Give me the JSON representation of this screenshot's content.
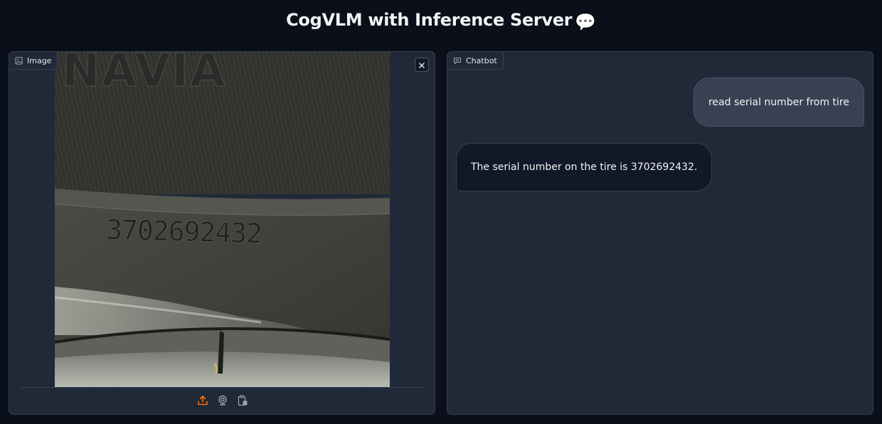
{
  "app": {
    "title": "CogVLM with Inference Server",
    "title_emoji": "💬"
  },
  "image_panel": {
    "label": "Image",
    "image_alt": "Photo of a tire sidewall with embossed serial number",
    "embossed_text": "3702692432",
    "embossed_top_text": "NAVIA",
    "label_icon": "image-icon",
    "close_icon": "close-icon",
    "toolbar": [
      {
        "name": "upload-icon",
        "color": "#f97316"
      },
      {
        "name": "webcam-icon",
        "color": "#9ca3af"
      },
      {
        "name": "clipboard-icon",
        "color": "#9ca3af"
      }
    ]
  },
  "chat_panel": {
    "label": "Chatbot",
    "label_icon": "chat-icon",
    "messages": [
      {
        "role": "user",
        "text": "read serial number from tire"
      },
      {
        "role": "bot",
        "text": "The serial number on the tire is 3702692432."
      }
    ]
  },
  "colors": {
    "background": "#0b0f19",
    "panel": "#1f2937",
    "border": "#374151",
    "accent": "#f97316"
  }
}
